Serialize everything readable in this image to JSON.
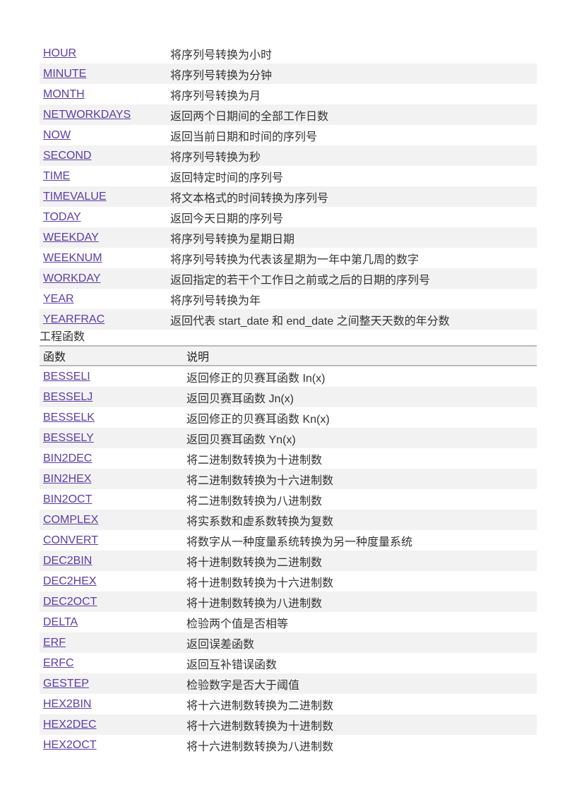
{
  "date_functions": [
    {
      "name": "HOUR",
      "desc": "将序列号转换为小时"
    },
    {
      "name": "MINUTE",
      "desc": "将序列号转换为分钟"
    },
    {
      "name": "MONTH",
      "desc": "将序列号转换为月"
    },
    {
      "name": "NETWORKDAYS",
      "desc": "返回两个日期间的全部工作日数"
    },
    {
      "name": "NOW",
      "desc": "返回当前日期和时间的序列号"
    },
    {
      "name": "SECOND",
      "desc": "将序列号转换为秒"
    },
    {
      "name": "TIME",
      "desc": "返回特定时间的序列号"
    },
    {
      "name": "TIMEVALUE",
      "desc": "将文本格式的时间转换为序列号"
    },
    {
      "name": "TODAY",
      "desc": "返回今天日期的序列号"
    },
    {
      "name": "WEEKDAY",
      "desc": "将序列号转换为星期日期"
    },
    {
      "name": "WEEKNUM",
      "desc": "将序列号转换为代表该星期为一年中第几周的数字"
    },
    {
      "name": "WORKDAY",
      "desc": "返回指定的若干个工作日之前或之后的日期的序列号"
    },
    {
      "name": "YEAR",
      "desc": "将序列号转换为年"
    },
    {
      "name": "YEARFRAC",
      "desc": "返回代表 start_date 和 end_date 之间整天天数的年分数"
    }
  ],
  "engineering": {
    "heading": "工程函数",
    "col_function": "函数",
    "col_description": "说明",
    "rows": [
      {
        "name": "BESSELI",
        "desc": "返回修正的贝赛耳函数 In(x)"
      },
      {
        "name": "BESSELJ",
        "desc": "返回贝赛耳函数 Jn(x)"
      },
      {
        "name": "BESSELK",
        "desc": "返回修正的贝赛耳函数 Kn(x)"
      },
      {
        "name": "BESSELY",
        "desc": "返回贝赛耳函数 Yn(x)"
      },
      {
        "name": "BIN2DEC",
        "desc": "将二进制数转换为十进制数"
      },
      {
        "name": "BIN2HEX",
        "desc": "将二进制数转换为十六进制数"
      },
      {
        "name": "BIN2OCT",
        "desc": "将二进制数转换为八进制数"
      },
      {
        "name": "COMPLEX",
        "desc": "将实系数和虚系数转换为复数"
      },
      {
        "name": "CONVERT",
        "desc": "将数字从一种度量系统转换为另一种度量系统"
      },
      {
        "name": "DEC2BIN",
        "desc": "将十进制数转换为二进制数"
      },
      {
        "name": "DEC2HEX",
        "desc": "将十进制数转换为十六进制数"
      },
      {
        "name": "DEC2OCT",
        "desc": "将十进制数转换为八进制数"
      },
      {
        "name": "DELTA",
        "desc": "检验两个值是否相等"
      },
      {
        "name": "ERF",
        "desc": "返回误差函数"
      },
      {
        "name": "ERFC",
        "desc": "返回互补错误函数"
      },
      {
        "name": "GESTEP",
        "desc": "检验数字是否大于阈值"
      },
      {
        "name": "HEX2BIN",
        "desc": "将十六进制数转换为二进制数"
      },
      {
        "name": "HEX2DEC",
        "desc": "将十六进制数转换为十进制数"
      },
      {
        "name": "HEX2OCT",
        "desc": "将十六进制数转换为八进制数"
      }
    ]
  },
  "colors": {
    "link": "#5b3ea6",
    "stripe": "#f2f2f2"
  }
}
